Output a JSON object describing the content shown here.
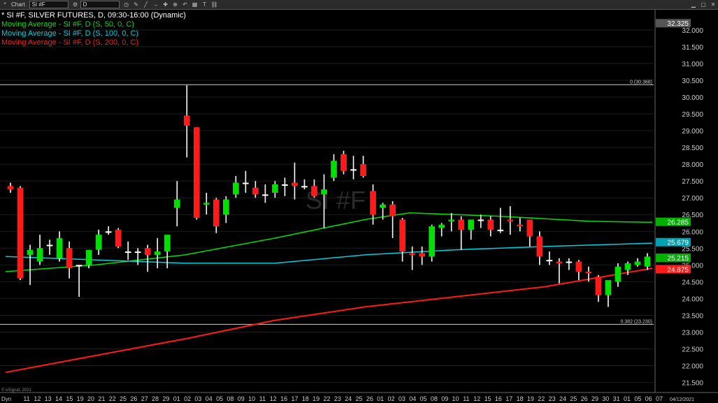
{
  "toolbar": {
    "app_label": "Chart",
    "symbol_value": "SI #F",
    "interval_value": "D",
    "icons": [
      "gear-icon",
      "clock-icon",
      "pencil-icon",
      "line-icon",
      "arrow-icon",
      "crosshair-icon",
      "zoom-icon",
      "undo-icon"
    ],
    "window_icons": [
      "minimize-icon",
      "maximize-icon",
      "close-icon"
    ]
  },
  "legend": {
    "main": "SI #F, SILVER FUTURES, D, 09:30-16:00 (Dynamic)",
    "ma50": "Moving Average - SI #F, D (S, 50, 0, C)",
    "ma100": "Moving Average - SI #F, D (S, 100, 0, C)",
    "ma200": "Moving Average - SI #F, D (S, 200, 0, C)"
  },
  "watermark": "SI #F",
  "copyright": "© eSignal, 2021",
  "bottom_left": "Dyn",
  "bottom_right_date": "04/12/2021",
  "colors": {
    "up": "#00e000",
    "down": "#ff1a1a",
    "neutral": "#ffffff",
    "ma50": "#00e000",
    "ma100": "#00d0e0",
    "ma200": "#ff1a1a",
    "axis_text": "#cccccc"
  },
  "chart_data": {
    "type": "candlestick",
    "ylim": [
      21.2,
      32.6
    ],
    "yticks": [
      21.5,
      22.0,
      22.5,
      23.0,
      23.5,
      24.0,
      24.5,
      25.0,
      25.5,
      26.0,
      26.5,
      27.0,
      27.5,
      28.0,
      28.5,
      29.0,
      29.5,
      30.0,
      30.5,
      31.0,
      31.5,
      32.0
    ],
    "ytick_labels": [
      "21.500",
      "22.000",
      "22.500",
      "23.000",
      "23.500",
      "24.000",
      "24.500",
      "25.000",
      "25.500",
      "26.000",
      "26.500",
      "27.000",
      "27.500",
      "28.000",
      "28.500",
      "29.000",
      "29.500",
      "30.000",
      "30.500",
      "31.000",
      "31.500",
      "32.000"
    ],
    "x_labels": [
      "11",
      "12",
      "13",
      "14",
      "15",
      "19",
      "20",
      "21",
      "22",
      "25",
      "26",
      "27",
      "28",
      "29",
      "01",
      "02",
      "03",
      "04",
      "05",
      "08",
      "09",
      "10",
      "11",
      "12",
      "16",
      "17",
      "18",
      "19",
      "22",
      "23",
      "24",
      "25",
      "26",
      "01",
      "02",
      "03",
      "04",
      "05",
      "08",
      "09",
      "10",
      "11",
      "12",
      "15",
      "16",
      "17",
      "18",
      "19",
      "22",
      "23",
      "24",
      "25",
      "26",
      "29",
      "30",
      "31",
      "01",
      "05",
      "06",
      "07"
    ],
    "candles": [
      {
        "o": 27.35,
        "h": 27.45,
        "l": 27.15,
        "c": 27.25
      },
      {
        "o": 27.3,
        "h": 27.35,
        "l": 24.55,
        "c": 24.6
      },
      {
        "o": 25.3,
        "h": 25.6,
        "l": 24.4,
        "c": 25.45
      },
      {
        "o": 25.1,
        "h": 25.9,
        "l": 25.0,
        "c": 25.5
      },
      {
        "o": 25.6,
        "h": 25.75,
        "l": 25.3,
        "c": 25.6
      },
      {
        "o": 25.2,
        "h": 26.0,
        "l": 25.1,
        "c": 25.8
      },
      {
        "o": 25.5,
        "h": 25.7,
        "l": 24.6,
        "c": 24.9
      },
      {
        "o": 25.0,
        "h": 25.0,
        "l": 24.05,
        "c": 25.0
      },
      {
        "o": 25.0,
        "h": 25.3,
        "l": 24.9,
        "c": 25.45
      },
      {
        "o": 25.45,
        "h": 26.05,
        "l": 25.3,
        "c": 25.9
      },
      {
        "o": 26.0,
        "h": 26.15,
        "l": 25.9,
        "c": 26.0
      },
      {
        "o": 26.05,
        "h": 26.1,
        "l": 25.5,
        "c": 25.55
      },
      {
        "o": 25.4,
        "h": 25.7,
        "l": 25.15,
        "c": 25.4
      },
      {
        "o": 25.4,
        "h": 25.5,
        "l": 25.0,
        "c": 25.4
      },
      {
        "o": 25.5,
        "h": 25.6,
        "l": 24.8,
        "c": 25.3
      },
      {
        "o": 25.3,
        "h": 25.8,
        "l": 24.9,
        "c": 25.4
      },
      {
        "o": 25.4,
        "h": 25.6,
        "l": 24.9,
        "c": 25.9
      },
      {
        "o": 26.7,
        "h": 27.5,
        "l": 26.15,
        "c": 26.95
      },
      {
        "o": 29.45,
        "h": 30.35,
        "l": 28.2,
        "c": 29.15
      },
      {
        "o": 29.1,
        "h": 29.1,
        "l": 26.35,
        "c": 26.4
      },
      {
        "o": 26.8,
        "h": 27.15,
        "l": 26.5,
        "c": 26.85
      },
      {
        "o": 26.95,
        "h": 27.0,
        "l": 25.95,
        "c": 26.15
      },
      {
        "o": 26.5,
        "h": 27.05,
        "l": 26.25,
        "c": 26.95
      },
      {
        "o": 27.1,
        "h": 27.65,
        "l": 27.0,
        "c": 27.45
      },
      {
        "o": 27.45,
        "h": 27.8,
        "l": 27.15,
        "c": 27.45
      },
      {
        "o": 27.3,
        "h": 27.5,
        "l": 27.0,
        "c": 27.1
      },
      {
        "o": 27.1,
        "h": 27.4,
        "l": 26.85,
        "c": 27.1
      },
      {
        "o": 27.15,
        "h": 27.5,
        "l": 27.0,
        "c": 27.4
      },
      {
        "o": 27.4,
        "h": 27.6,
        "l": 27.05,
        "c": 27.4
      },
      {
        "o": 27.45,
        "h": 28.05,
        "l": 26.95,
        "c": 27.35
      },
      {
        "o": 27.35,
        "h": 27.55,
        "l": 27.25,
        "c": 27.35
      },
      {
        "o": 27.35,
        "h": 27.55,
        "l": 27.0,
        "c": 27.05
      },
      {
        "o": 27.1,
        "h": 27.7,
        "l": 26.1,
        "c": 27.25
      },
      {
        "o": 27.6,
        "h": 28.3,
        "l": 27.5,
        "c": 28.1
      },
      {
        "o": 28.3,
        "h": 28.4,
        "l": 27.7,
        "c": 27.8
      },
      {
        "o": 27.85,
        "h": 28.25,
        "l": 27.55,
        "c": 27.85
      },
      {
        "o": 28.0,
        "h": 28.25,
        "l": 27.6,
        "c": 27.65
      },
      {
        "o": 27.2,
        "h": 27.4,
        "l": 26.2,
        "c": 26.5
      },
      {
        "o": 26.7,
        "h": 26.85,
        "l": 26.35,
        "c": 26.8
      },
      {
        "o": 26.8,
        "h": 26.9,
        "l": 25.8,
        "c": 26.45
      },
      {
        "o": 26.35,
        "h": 26.4,
        "l": 25.1,
        "c": 25.4
      },
      {
        "o": 25.35,
        "h": 25.55,
        "l": 24.85,
        "c": 25.3
      },
      {
        "o": 25.35,
        "h": 25.55,
        "l": 25.0,
        "c": 25.25
      },
      {
        "o": 25.25,
        "h": 26.2,
        "l": 25.1,
        "c": 26.15
      },
      {
        "o": 26.1,
        "h": 26.25,
        "l": 25.85,
        "c": 26.2
      },
      {
        "o": 26.3,
        "h": 26.55,
        "l": 26.0,
        "c": 26.35
      },
      {
        "o": 26.35,
        "h": 26.45,
        "l": 25.45,
        "c": 26.05
      },
      {
        "o": 26.05,
        "h": 26.35,
        "l": 25.75,
        "c": 26.35
      },
      {
        "o": 26.35,
        "h": 26.5,
        "l": 26.1,
        "c": 26.35
      },
      {
        "o": 26.35,
        "h": 26.45,
        "l": 25.85,
        "c": 26.05
      },
      {
        "o": 26.05,
        "h": 26.7,
        "l": 25.95,
        "c": 26.05
      },
      {
        "o": 26.35,
        "h": 26.75,
        "l": 25.9,
        "c": 26.3
      },
      {
        "o": 26.2,
        "h": 26.4,
        "l": 26.0,
        "c": 26.15
      },
      {
        "o": 26.35,
        "h": 26.35,
        "l": 25.55,
        "c": 25.85
      },
      {
        "o": 25.85,
        "h": 26.0,
        "l": 25.0,
        "c": 25.25
      },
      {
        "o": 25.15,
        "h": 25.4,
        "l": 25.0,
        "c": 25.15
      },
      {
        "o": 25.1,
        "h": 25.2,
        "l": 24.45,
        "c": 25.05
      },
      {
        "o": 25.1,
        "h": 25.2,
        "l": 24.85,
        "c": 25.1
      },
      {
        "o": 25.1,
        "h": 25.15,
        "l": 24.55,
        "c": 24.8
      },
      {
        "o": 24.8,
        "h": 24.95,
        "l": 24.5,
        "c": 24.75
      },
      {
        "o": 24.65,
        "h": 24.7,
        "l": 23.9,
        "c": 24.1
      },
      {
        "o": 24.1,
        "h": 24.5,
        "l": 23.75,
        "c": 24.55
      },
      {
        "o": 24.5,
        "h": 25.05,
        "l": 24.35,
        "c": 24.95
      },
      {
        "o": 24.85,
        "h": 25.1,
        "l": 24.7,
        "c": 25.05
      },
      {
        "o": 25.0,
        "h": 25.2,
        "l": 24.95,
        "c": 25.1
      },
      {
        "o": 24.95,
        "h": 25.35,
        "l": 24.85,
        "c": 25.25
      }
    ],
    "ma50": [
      [
        0,
        24.8
      ],
      [
        10,
        25.0
      ],
      [
        20,
        25.3
      ],
      [
        30,
        25.8
      ],
      [
        40,
        26.35
      ],
      [
        45,
        26.55
      ],
      [
        55,
        26.45
      ],
      [
        65,
        26.3
      ],
      [
        72,
        26.27
      ]
    ],
    "ma100": [
      [
        0,
        25.25
      ],
      [
        10,
        25.15
      ],
      [
        20,
        25.05
      ],
      [
        30,
        25.05
      ],
      [
        40,
        25.3
      ],
      [
        50,
        25.45
      ],
      [
        60,
        25.55
      ],
      [
        72,
        25.65
      ]
    ],
    "ma200": [
      [
        0,
        21.8
      ],
      [
        10,
        22.3
      ],
      [
        20,
        22.8
      ],
      [
        30,
        23.35
      ],
      [
        40,
        23.75
      ],
      [
        50,
        24.05
      ],
      [
        60,
        24.35
      ],
      [
        72,
        24.9
      ]
    ],
    "fib_levels": [
      {
        "value": 30.368,
        "label": "0 (30.368)"
      },
      {
        "value": 23.23,
        "label": "0.382 (23.230)"
      }
    ],
    "price_tags": [
      {
        "value": 32.2,
        "label": "32.325",
        "bg": "#555555",
        "fg": "#ffffff"
      },
      {
        "value": 26.285,
        "label": "26.285",
        "bg": "#00b000",
        "fg": "#ffffff"
      },
      {
        "value": 25.679,
        "label": "25.679",
        "bg": "#00a0b0",
        "fg": "#ffffff"
      },
      {
        "value": 25.215,
        "label": "25.215",
        "bg": "#00b000",
        "fg": "#ffffff"
      },
      {
        "value": 24.875,
        "label": "24.875",
        "bg": "#ff1a1a",
        "fg": "#ffffff"
      }
    ]
  }
}
